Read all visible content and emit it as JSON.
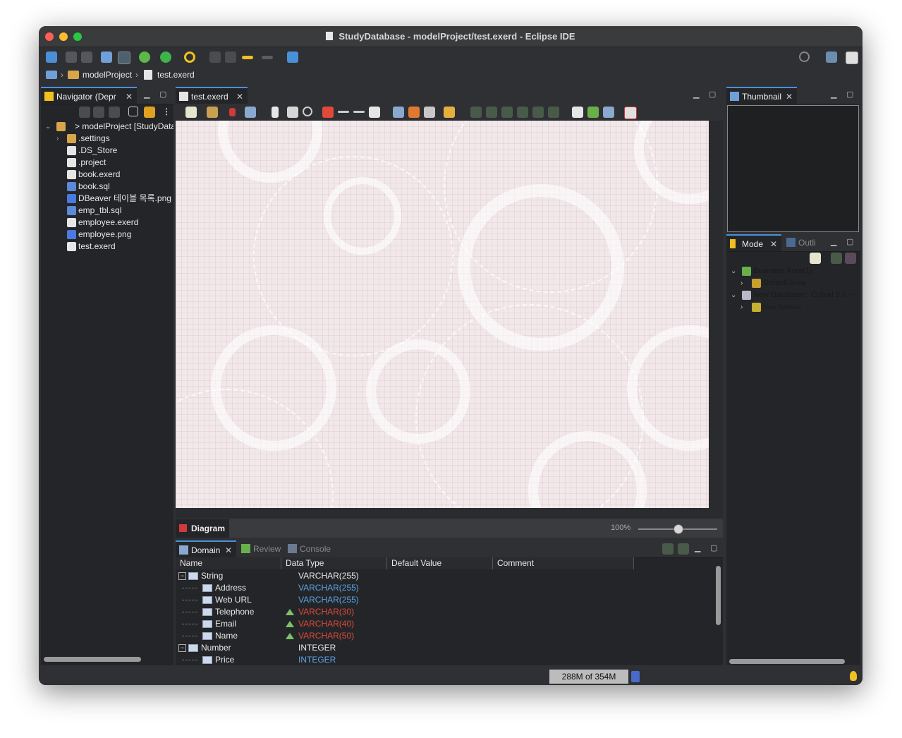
{
  "window": {
    "title": "StudyDatabase - modelProject/test.exerd - Eclipse IDE"
  },
  "breadcrumb": {
    "project": "modelProject",
    "file": "test.exerd"
  },
  "navigator": {
    "tab_label": "Navigator (Depr",
    "root": "> modelProject [StudyDatab",
    "items": [
      {
        "label": ".settings",
        "type": "folder"
      },
      {
        "label": ".DS_Store",
        "type": "file"
      },
      {
        "label": ".project",
        "type": "file"
      },
      {
        "label": "book.exerd",
        "type": "exerd"
      },
      {
        "label": "book.sql",
        "type": "sql"
      },
      {
        "label": "DBeaver 테이블 목록.png",
        "type": "image"
      },
      {
        "label": "emp_tbl.sql",
        "type": "sql"
      },
      {
        "label": "employee.exerd",
        "type": "exerd"
      },
      {
        "label": "employee.png",
        "type": "image"
      },
      {
        "label": "test.exerd",
        "type": "exerd"
      }
    ]
  },
  "editor": {
    "tab_label": "test.exerd",
    "bottom_tab": "Diagram",
    "zoom": "100%",
    "zoom_level": 0.5
  },
  "thumbnail": {
    "tab_label": "Thumbnail"
  },
  "model": {
    "tab_label": "Mode",
    "tab2_label": "Outli",
    "items": [
      {
        "label": "Business Area(1)",
        "level": 0
      },
      {
        "label": "Default Area",
        "level": 1
      },
      {
        "label": "New Database : Cubrid 9.0 ~",
        "level": 0
      },
      {
        "label": "New Schema",
        "level": 1
      }
    ]
  },
  "bottom": {
    "tabs": [
      "Domain",
      "Review",
      "Console"
    ],
    "columns": [
      "Name",
      "Data Type",
      "Default Value",
      "Comment"
    ],
    "rows": [
      {
        "name": "String",
        "type": "VARCHAR(255)",
        "level": 0,
        "color": "white",
        "warn": false
      },
      {
        "name": "Address",
        "type": "VARCHAR(255)",
        "level": 1,
        "color": "blue",
        "warn": false
      },
      {
        "name": "Web URL",
        "type": "VARCHAR(255)",
        "level": 1,
        "color": "blue",
        "warn": false
      },
      {
        "name": "Telephone",
        "type": "VARCHAR(30)",
        "level": 1,
        "color": "red",
        "warn": true
      },
      {
        "name": "Email",
        "type": "VARCHAR(40)",
        "level": 1,
        "color": "red",
        "warn": true
      },
      {
        "name": "Name",
        "type": "VARCHAR(50)",
        "level": 1,
        "color": "red",
        "warn": true
      },
      {
        "name": "Number",
        "type": "INTEGER",
        "level": 0,
        "color": "white",
        "warn": false
      },
      {
        "name": "Price",
        "type": "INTEGER",
        "level": 1,
        "color": "blue",
        "warn": false
      }
    ]
  },
  "status": {
    "memory": "288M of 354M"
  },
  "colors": {
    "accent": "#4a90d9",
    "blue_type": "#5aa4e6",
    "red_type": "#e04a3a"
  }
}
